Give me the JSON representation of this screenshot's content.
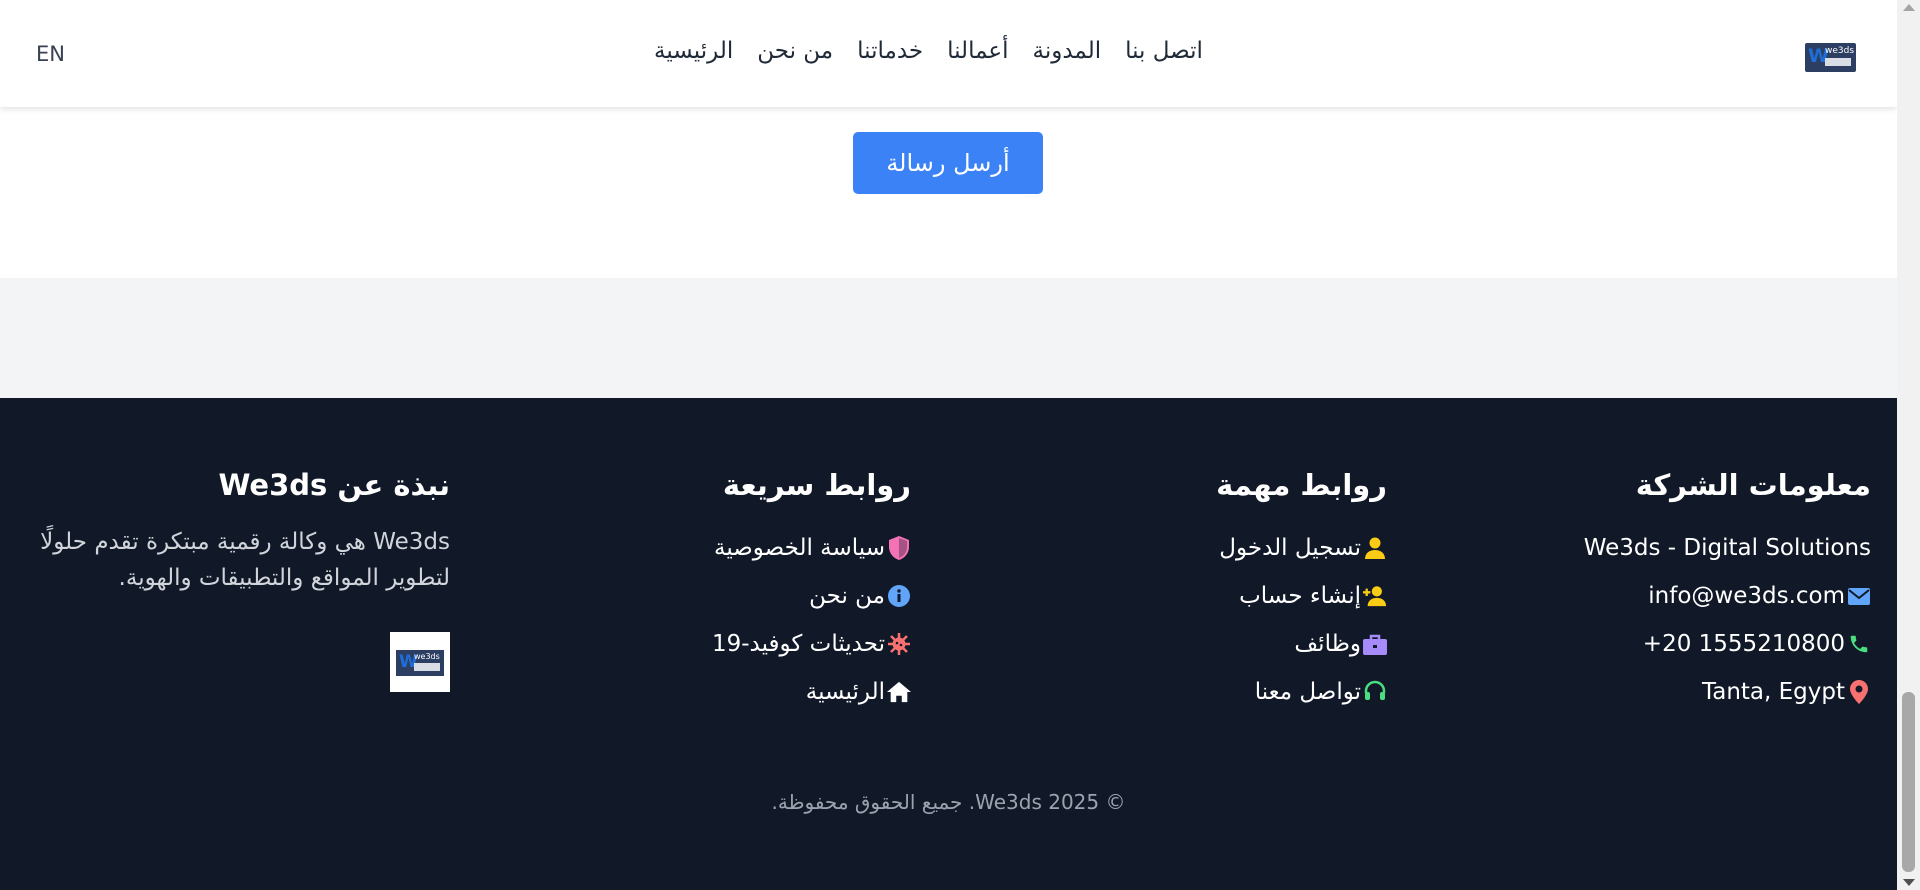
{
  "header": {
    "lang_label": "EN",
    "nav": [
      "الرئيسية",
      "من نحن",
      "خدماتنا",
      "أعمالنا",
      "المدونة",
      "اتصل بنا"
    ],
    "logo_text": "we3ds"
  },
  "contact": {
    "send_button": "أرسل رسالة"
  },
  "footer": {
    "company_info": {
      "title": "معلومات الشركة",
      "name": "We3ds - Digital Solutions",
      "email": "info@we3ds.com",
      "phone": "1555210800 20+",
      "location": "Tanta, Egypt"
    },
    "important_links": {
      "title": "روابط مهمة",
      "items": [
        "تسجيل الدخول",
        "إنشاء حساب",
        "وظائف",
        "تواصل معنا"
      ]
    },
    "quick_links": {
      "title": "روابط سريعة",
      "items": [
        "سياسة الخصوصية",
        "من نحن",
        "تحديثات كوفيد-19",
        "الرئيسية"
      ]
    },
    "about": {
      "title": "نبذة عن We3ds",
      "text": "We3ds هي وكالة رقمية مبتكرة تقدم حلولًا لتطوير المواقع والتطبيقات والهوية."
    },
    "copyright": "© We3ds 2025. جميع الحقوق محفوظة."
  },
  "colors": {
    "accent": "#3b82f6",
    "footer_bg": "#111827",
    "icon_yellow": "#facc15",
    "icon_purple": "#a78bfa",
    "icon_green": "#4ade80",
    "icon_red": "#f87171",
    "icon_pink": "#f472b6",
    "icon_blue": "#60a5fa",
    "icon_orange": "#f87171"
  }
}
